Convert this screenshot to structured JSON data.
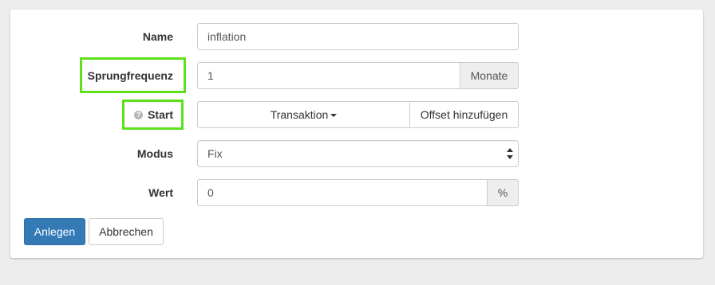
{
  "form": {
    "name": {
      "label": "Name",
      "value": "inflation"
    },
    "sprungfrequenz": {
      "label": "Sprungfrequenz",
      "value": "1",
      "addon": "Monate"
    },
    "start": {
      "label": "Start",
      "help_icon": "question-circle-icon",
      "dropdown_label": "Transaktion",
      "offset_button": "Offset hinzufügen"
    },
    "modus": {
      "label": "Modus",
      "selected": "Fix"
    },
    "wert": {
      "label": "Wert",
      "value": "0",
      "addon": "%"
    }
  },
  "actions": {
    "create_label": "Anlegen",
    "cancel_label": "Abbrechen"
  },
  "colors": {
    "highlight": "#5fe019",
    "primary": "#337ab7"
  }
}
